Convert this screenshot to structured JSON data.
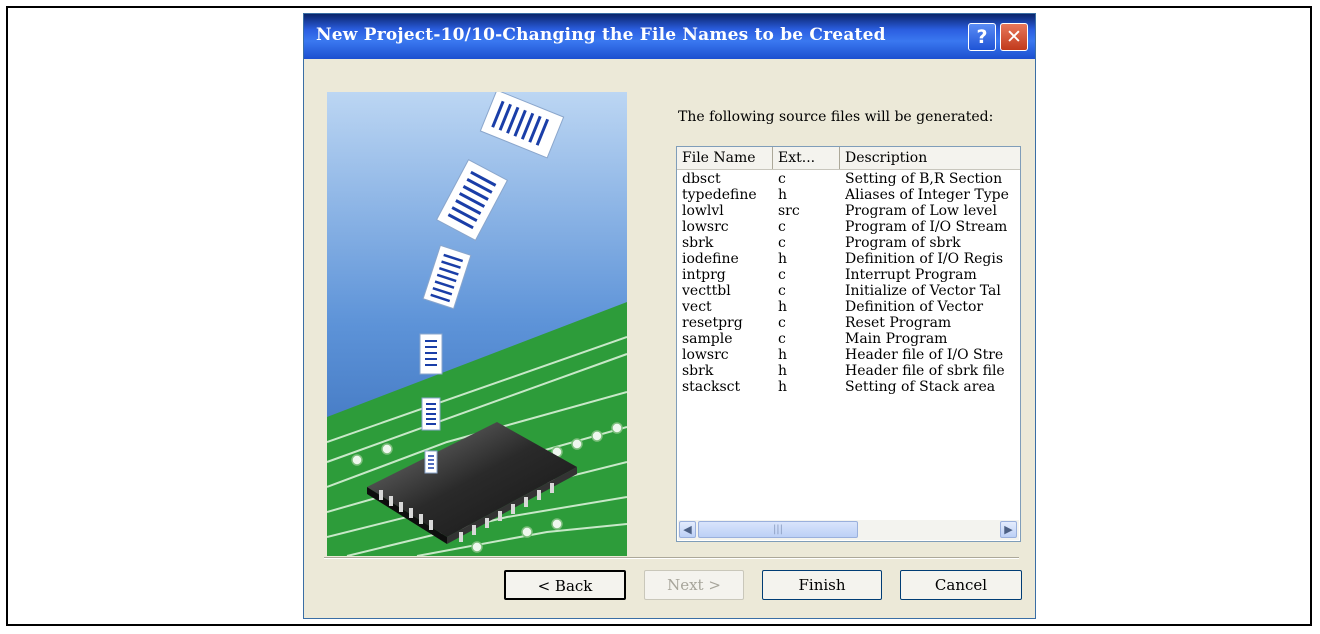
{
  "window": {
    "title": "New Project-10/10-Changing the File Names to be Created",
    "help_glyph": "?",
    "close_glyph": "✕"
  },
  "intro_text": "The following source files will be generated:",
  "columns": {
    "name": "File Name",
    "ext": "Ext...",
    "description": "Description"
  },
  "files": [
    {
      "name": "dbsct",
      "ext": "c",
      "description": "Setting of B,R Section"
    },
    {
      "name": "typedefine",
      "ext": "h",
      "description": "Aliases of Integer Type"
    },
    {
      "name": "lowlvl",
      "ext": "src",
      "description": "Program of Low level"
    },
    {
      "name": "lowsrc",
      "ext": "c",
      "description": "Program of I/O Stream"
    },
    {
      "name": "sbrk",
      "ext": "c",
      "description": "Program of sbrk"
    },
    {
      "name": "iodefine",
      "ext": "h",
      "description": "Definition of I/O Regis"
    },
    {
      "name": "intprg",
      "ext": "c",
      "description": "Interrupt Program"
    },
    {
      "name": "vecttbl",
      "ext": "c",
      "description": "Initialize of Vector Tal"
    },
    {
      "name": "vect",
      "ext": "h",
      "description": "Definition of Vector"
    },
    {
      "name": "resetprg",
      "ext": "c",
      "description": "Reset Program"
    },
    {
      "name": "sample",
      "ext": "c",
      "description": "Main Program"
    },
    {
      "name": "lowsrc",
      "ext": "h",
      "description": "Header file of I/O Stre"
    },
    {
      "name": "sbrk",
      "ext": "h",
      "description": "Header file of sbrk file"
    },
    {
      "name": "stacksct",
      "ext": "h",
      "description": "Setting of Stack area"
    }
  ],
  "scrollbar": {
    "left_arrow": "◀",
    "right_arrow": "▶",
    "thumb_grip": "|||"
  },
  "buttons": {
    "back": "< Back",
    "next": "Next >",
    "finish": "Finish",
    "cancel": "Cancel"
  },
  "colors": {
    "title_bar": "#2b5ee0",
    "dialog_bg": "#ece9d8",
    "close_red": "#c13a1c",
    "pcb_green": "#2d9c3a",
    "sky_blue": "#3b78c8"
  }
}
